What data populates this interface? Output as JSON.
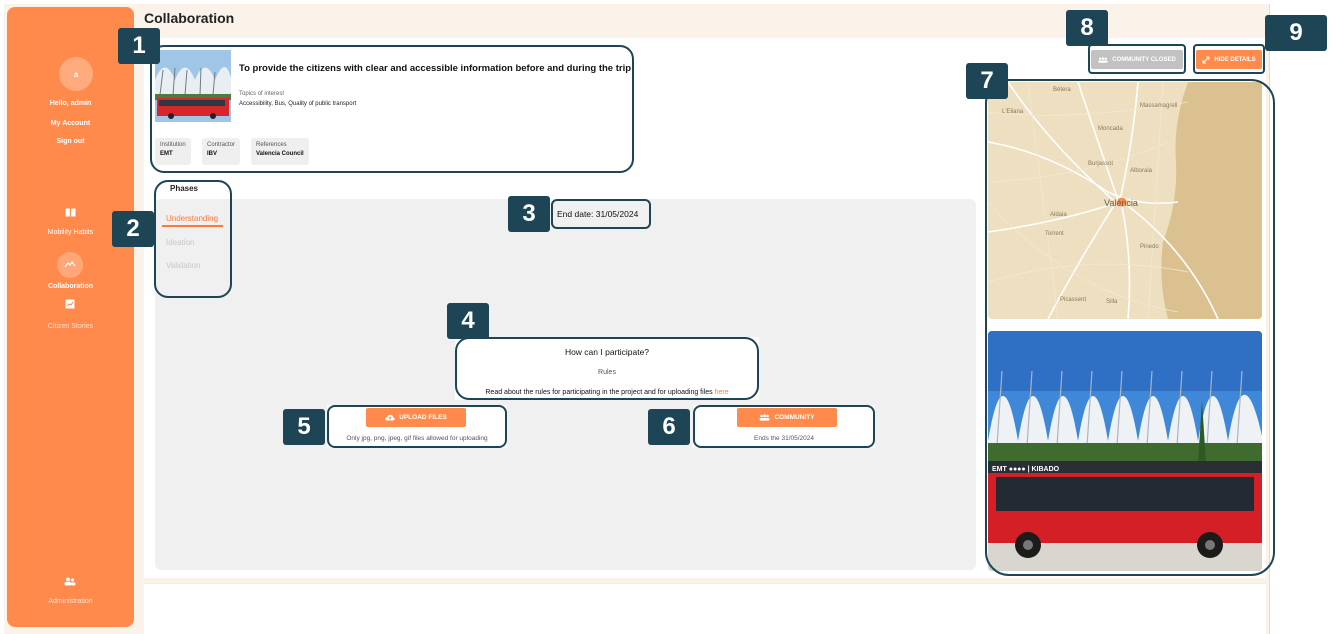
{
  "page": {
    "title": "Collaboration"
  },
  "sidebar": {
    "avatar_initial": "a",
    "greeting": "Hello, admin",
    "my_account": "My Account",
    "sign_out": "Sign out",
    "items": [
      {
        "label": "Mobility Habits",
        "icon": "book-icon"
      },
      {
        "label": "Collaboration",
        "icon": "handshake-icon"
      },
      {
        "label": "Citizen Stories",
        "icon": "stories-icon"
      }
    ],
    "admin": {
      "label": "Administration",
      "icon": "users-icon"
    }
  },
  "project": {
    "title": "To provide the citizens with clear and accessible information before and during the trip",
    "topics_label": "Topics of interest",
    "topics_value": "Accessibility, Bus, Quality of public transport",
    "chips": [
      {
        "label": "Institution",
        "value": "EMT"
      },
      {
        "label": "Contractor",
        "value": "IBV"
      },
      {
        "label": "References",
        "value": "Valencia Council"
      }
    ]
  },
  "phases": {
    "tab_label": "Phases",
    "items": [
      "Understanding",
      "Ideation",
      "Validation"
    ],
    "active_index": 0
  },
  "end_date": "End date: 31/05/2024",
  "participate": {
    "title": "How can I participate?",
    "rules": "Rules",
    "read_text": "Read about the rules for participating in the project and for uploading files",
    "link_text": "here"
  },
  "upload": {
    "button_label": "UPLOAD FILES",
    "note": "Only jpg, png, jpeg, gif files allowed for uploading"
  },
  "community": {
    "button_label": "COMMUNITY",
    "note": "Ends the 31/05/2024"
  },
  "top_actions": {
    "community_closed": "COMMUNITY CLOSED",
    "hide_details": "HIDE DETAILS"
  },
  "map_labels": [
    "Bétera",
    "L'Eliana",
    "Massamagrell",
    "Moncada",
    "Burjassot",
    "Alboraia",
    "València",
    "Aldaia",
    "Torrent",
    "Picassent",
    "Silla",
    "Pinedo"
  ],
  "photo_bus_text": "EMT ●●●● | KIBADO",
  "annotations": [
    "1",
    "2",
    "3",
    "4",
    "5",
    "6",
    "7",
    "8",
    "9"
  ],
  "colors": {
    "accent": "#ff8a4c",
    "callout": "#1d4555",
    "panel": "#f0f0f0"
  }
}
